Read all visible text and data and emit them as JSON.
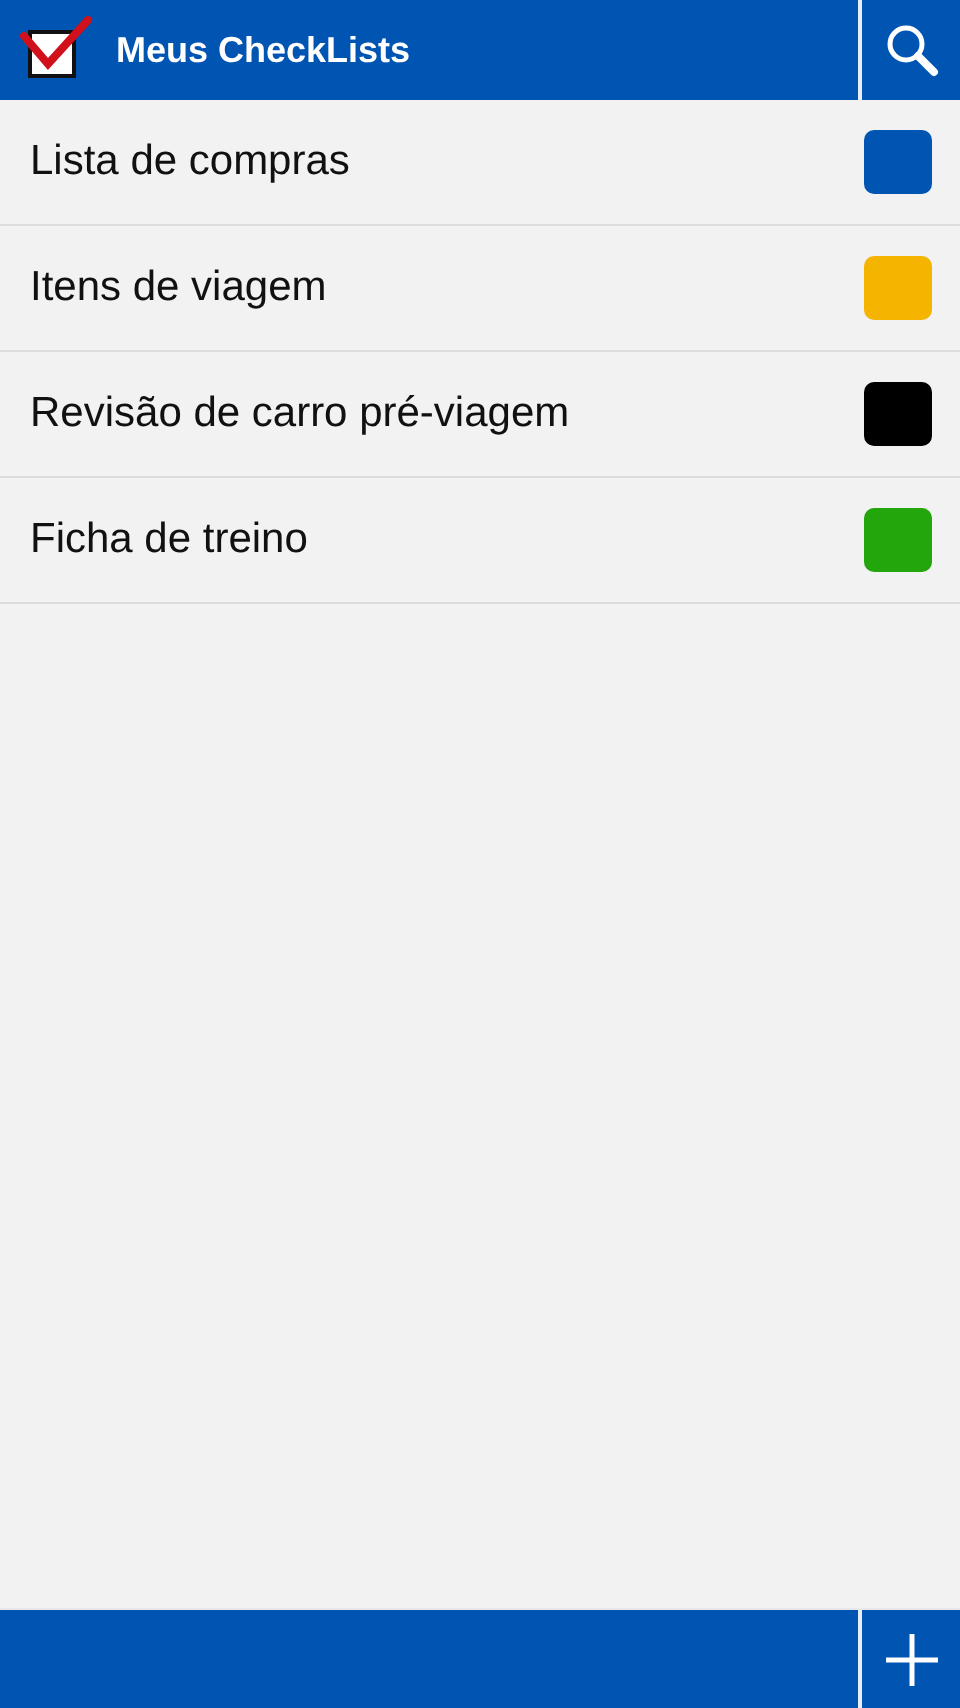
{
  "header": {
    "title": "Meus CheckLists"
  },
  "lists": [
    {
      "name": "Lista de compras",
      "color": "#0055b3"
    },
    {
      "name": "Itens de viagem",
      "color": "#f5b400"
    },
    {
      "name": "Revisão de carro pré-viagem",
      "color": "#000000"
    },
    {
      "name": "Ficha de treino",
      "color": "#22a60c"
    }
  ]
}
